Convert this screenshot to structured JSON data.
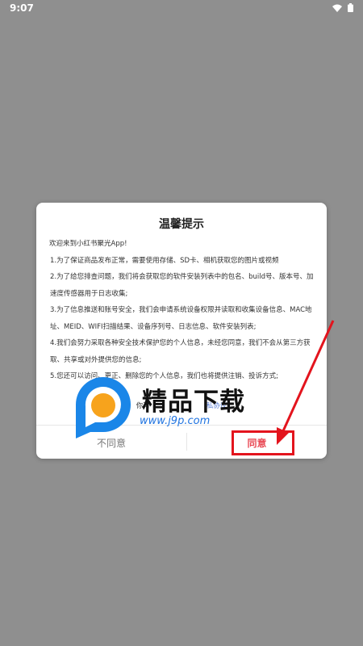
{
  "status_bar": {
    "time": "9:07"
  },
  "dialog": {
    "title": "温馨提示",
    "greeting": "欢迎来到小红书聚光App!",
    "items": [
      "1.为了保证商品发布正常，需要使用存储、SD卡、相机获取您的图片或视频",
      "2.为了给您排查问题，我们将会获取您的软件安装列表中的包名、build号、版本号、加速度传感器用于日志收集;",
      "3.为了信息推送和账号安全，我们会申请系统设备权限并读取和收集设备信息、MAC地址、MEID、WIFI扫描结果、设备序列号、日志信息、软件安装列表;",
      "4.我们会努力采取各种安全技术保护您的个人信息，未经您同意，我们不会从第三方获取、共享或对外提供您的信息;",
      "5.您还可以访问、更正、删除您的个人信息，我们也将提供注销、投诉方式;"
    ],
    "privacy_prefix": "你可",
    "privacy_link": "私协议",
    "disagree_label": "不同意",
    "agree_label": "同意"
  },
  "watermark": {
    "title": "精品下载",
    "url": "www.j9p.com"
  },
  "colors": {
    "agree": "#e94b56",
    "highlight": "#e3141d",
    "overlay": "#8f8f8f"
  }
}
